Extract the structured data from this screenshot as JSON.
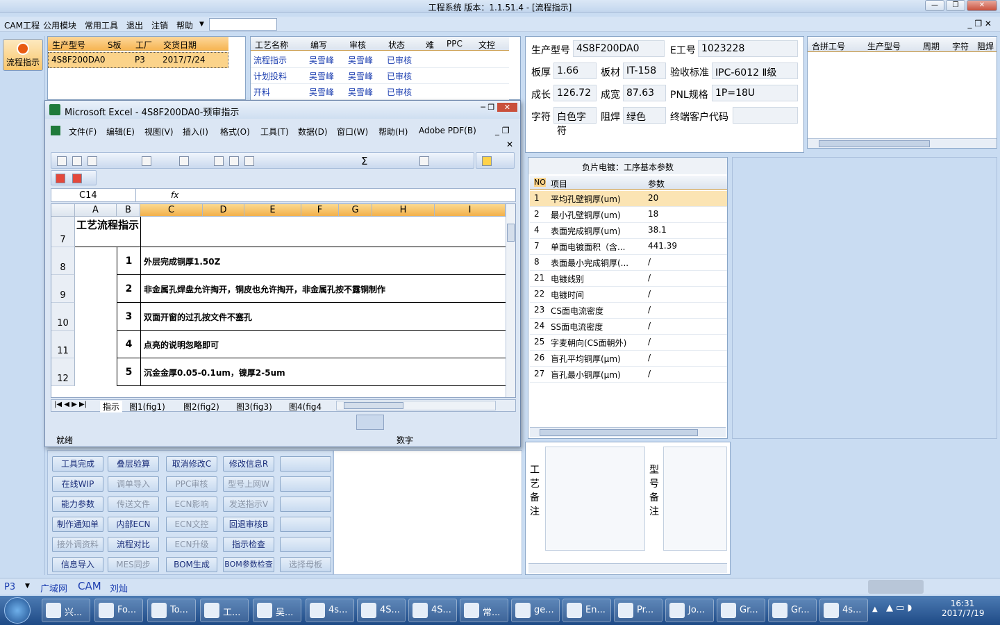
{
  "window": {
    "title": "工程系统    版本：1.1.51.4 - [流程指示]"
  },
  "menu": {
    "items": [
      "CAM工程",
      "公用模块",
      "常用工具",
      "退出",
      "注销",
      "帮助"
    ]
  },
  "sidebar": {
    "flow_button": "流程指示"
  },
  "order_table": {
    "headers": [
      "生产型号",
      "S板",
      "工厂",
      "交货日期"
    ],
    "row": [
      "4S8F200DA0",
      "",
      "P3",
      "2017/7/24"
    ]
  },
  "process_table": {
    "headers": [
      "工艺名称",
      "编写",
      "审核",
      "状态",
      "难",
      "PPC",
      "文控"
    ],
    "rows": [
      [
        "流程指示",
        "吴雪峰",
        "吴雪峰",
        "已审核"
      ],
      [
        "计划投料",
        "吴雪峰",
        "吴雪峰",
        "已审核"
      ],
      [
        "开料",
        "吴雪峰",
        "吴雪峰",
        "已审核"
      ]
    ]
  },
  "info": {
    "model_label": "生产型号",
    "model": "4S8F200DA0",
    "e_label": "E工号",
    "e_no": "1023228",
    "thick_label": "板厚",
    "thick": "1.66",
    "mat_label": "板材",
    "mat": "IT-158",
    "std_label": "验收标准",
    "std": "IPC-6012 Ⅱ级",
    "len_label": "成长",
    "len": "126.72",
    "wid_label": "成宽",
    "wid": "87.63",
    "pnl_label": "PNL规格",
    "pnl": "1P=18U",
    "char_label": "字符",
    "char": "白色字符",
    "mask_label": "阻焊",
    "mask": "绿色",
    "cust_label": "终端客户代码",
    "cust": ""
  },
  "merge_table": {
    "headers": [
      "合拼工号",
      "生产型号",
      "周期",
      "字符",
      "阻焊"
    ]
  },
  "params": {
    "title": "负片电镀：工序基本参数",
    "headers": [
      "NO",
      "项目",
      "参数"
    ],
    "rows": [
      [
        "1",
        "平均孔壁铜厚(um)",
        "20"
      ],
      [
        "2",
        "最小孔壁铜厚(um)",
        "18"
      ],
      [
        "4",
        "表面完成铜厚(um)",
        "38.1"
      ],
      [
        "7",
        "单面电镀面积（含...",
        "441.39"
      ],
      [
        "8",
        "表面最小完成铜厚(...",
        "/"
      ],
      [
        "21",
        "电镀线别",
        "/"
      ],
      [
        "22",
        "电镀时间",
        "/"
      ],
      [
        "23",
        "CS面电流密度",
        "/"
      ],
      [
        "24",
        "SS面电流密度",
        "/"
      ],
      [
        "25",
        "字麦朝向(CS面朝外)",
        "/"
      ],
      [
        "26",
        "盲孔平均铜厚(μm)",
        "/"
      ],
      [
        "27",
        "盲孔最小铜厚(μm)",
        "/"
      ]
    ]
  },
  "remarks": {
    "process": "工艺备注",
    "model": "型号备注"
  },
  "buttons": [
    [
      "工具完成",
      "叠层验算",
      "取消修改C",
      "修改信息R",
      ""
    ],
    [
      "在线WIP",
      "调单导入",
      "PPC审核",
      "型号上网W",
      ""
    ],
    [
      "能力参数",
      "传送文件",
      "ECN影响",
      "发送指示V",
      ""
    ],
    [
      "制作通知单",
      "内部ECN",
      "ECN文控",
      "回退审核B",
      ""
    ],
    [
      "接外调资料",
      "流程对比",
      "ECN升级",
      "指示检查",
      ""
    ],
    [
      "信息导入",
      "MES同步",
      "BOM生成",
      "BOM参数检查",
      "选择母板"
    ]
  ],
  "excel": {
    "title": "Microsoft Excel - 4S8F200DA0-预审指示",
    "menu": [
      "文件(F)",
      "编辑(E)",
      "视图(V)",
      "插入(I)",
      "格式(O)",
      "工具(T)",
      "数据(D)",
      "窗口(W)",
      "帮助(H)",
      "Adobe PDF(B)"
    ],
    "namebox": "C14",
    "fx": "fx",
    "cols": [
      "A",
      "B",
      "C",
      "D",
      "E",
      "F",
      "G",
      "H",
      "I"
    ],
    "rows": [
      {
        "n": "7",
        "a": "工艺流程指示",
        "b": "",
        "c": ""
      },
      {
        "n": "8",
        "b": "1",
        "c": "外层完成铜厚1.50Z"
      },
      {
        "n": "9",
        "b": "2",
        "c": "非金属孔焊盘允许掏开，铜皮也允许掏开，非金属孔按不露铜制作"
      },
      {
        "n": "10",
        "b": "3",
        "c": "双面开窗的过孔按文件不塞孔"
      },
      {
        "n": "11",
        "b": "4",
        "c": "点亮的说明忽略即可"
      },
      {
        "n": "12",
        "b": "5",
        "c": "沉金金厚0.05-0.1um，镍厚2-5um"
      }
    ],
    "tabs": [
      "指示",
      "图1(fig1)",
      "图2(fig2)",
      "图3(fig3)",
      "图4(fig4"
    ],
    "status_left": "就绪",
    "status_mid": "数字"
  },
  "statusbar": {
    "plant": "P3",
    "items": [
      "广域网",
      "CAM",
      "刘灿"
    ]
  },
  "taskbar": {
    "items": [
      "兴...",
      "Fo...",
      "To...",
      "工...",
      "吴...",
      "4s...",
      "4S...",
      "4S...",
      "常...",
      "ge...",
      "En...",
      "Pr...",
      "Jo...",
      "Gr...",
      "Gr...",
      "4s..."
    ],
    "time": "16:31",
    "date": "2017/7/19"
  },
  "colors": {
    "accent": "#f6b553",
    "bg": "#c9dcf2"
  }
}
